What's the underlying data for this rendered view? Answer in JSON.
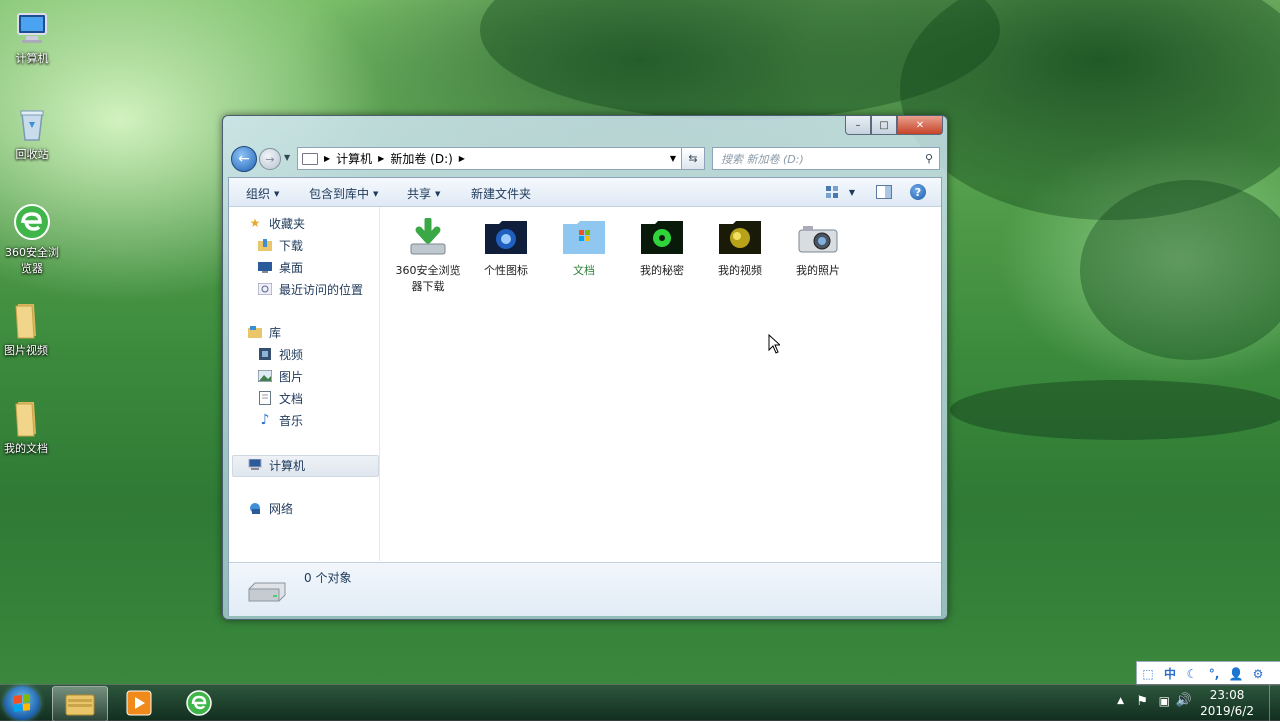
{
  "desktop": {
    "icons": [
      {
        "label": "计算机",
        "icon": "computer-icon"
      },
      {
        "label": "回收站",
        "icon": "recycle-bin-icon"
      },
      {
        "label": "360安全浏览器",
        "icon": "browser-360-icon"
      },
      {
        "label": "图片视频",
        "icon": "folder-icon"
      },
      {
        "label": "我的文档",
        "icon": "folder-icon"
      }
    ]
  },
  "window": {
    "caption": {
      "minimize": "–",
      "maximize": "□",
      "close": "✕"
    },
    "address": {
      "crumbs": [
        "计算机",
        "新加卷 (D:)"
      ],
      "search_placeholder": "搜索 新加卷 (D:)"
    },
    "toolbar": {
      "organize": "组织",
      "include_in_library": "包含到库中",
      "share": "共享",
      "new_folder": "新建文件夹"
    },
    "nav_pane": {
      "favorites": {
        "label": "收藏夹",
        "items": [
          "下载",
          "桌面",
          "最近访问的位置"
        ]
      },
      "libraries": {
        "label": "库",
        "items": [
          "视频",
          "图片",
          "文档",
          "音乐"
        ]
      },
      "computer": "计算机",
      "network": "网络"
    },
    "files": [
      {
        "label": "360安全浏览器下载",
        "icon": "download-folder-icon"
      },
      {
        "label": "个性图标",
        "icon": "dark-blue-folder-icon"
      },
      {
        "label": "文档",
        "icon": "windows-folder-icon"
      },
      {
        "label": "我的秘密",
        "icon": "green-folder-icon"
      },
      {
        "label": "我的视频",
        "icon": "gold-folder-icon"
      },
      {
        "label": "我的照片",
        "icon": "camera-folder-icon"
      }
    ],
    "status": {
      "text": "0 个对象"
    }
  },
  "taskbar": {
    "clock": {
      "time": "23:08",
      "date": "2019/6/2"
    },
    "apps": [
      "explorer",
      "media-player",
      "browser-360"
    ]
  },
  "ime": {
    "mode": "中"
  },
  "colors": {
    "accent": "#1f63b8",
    "close": "#c7432a",
    "text": "#1e395b"
  }
}
